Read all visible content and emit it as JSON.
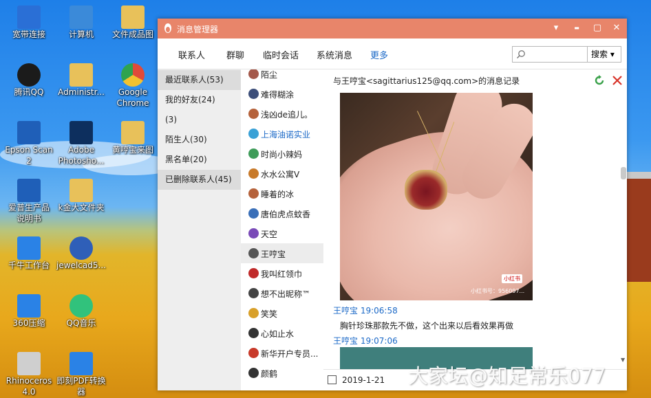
{
  "desktop": {
    "icons": [
      {
        "label": "宽带连接",
        "icon": "network-icon",
        "color": "#2a6fd6"
      },
      {
        "label": "计算机",
        "icon": "computer-icon",
        "color": "#3b8ad9"
      },
      {
        "label": "文件成品图",
        "icon": "folder-icon",
        "color": "#e8c15a"
      },
      {
        "label": "腾讯QQ",
        "icon": "qq-icon",
        "color": "#1b1b1b"
      },
      {
        "label": "Administr...",
        "icon": "user-folder-icon",
        "color": "#e8c15a"
      },
      {
        "label": "Google",
        "label2": "Chrome",
        "icon": "chrome-icon",
        "color": "#e04a3a"
      },
      {
        "label": "Epson Scan",
        "label2": "2",
        "icon": "scanner-icon",
        "color": "#1f5fb8"
      },
      {
        "label": "Adobe",
        "label2": "Photosho...",
        "icon": "photoshop-icon",
        "color": "#0d2f5e"
      },
      {
        "label": "黄哼宝来图",
        "icon": "folder-icon",
        "color": "#e8c15a"
      },
      {
        "label": "爱普生产品",
        "label2": "说明书",
        "icon": "manual-icon",
        "color": "#1f5fb8"
      },
      {
        "label": "k金大文件夹",
        "icon": "folder-icon",
        "color": "#e8c15a"
      },
      {
        "label": "千牛工作台",
        "icon": "qianniu-icon",
        "color": "#2a82e6"
      },
      {
        "label": "jewelcad5...",
        "icon": "jewelcad-icon",
        "color": "#2f5fb8"
      },
      {
        "label": "360压缩",
        "icon": "zip-icon",
        "color": "#2a82e6"
      },
      {
        "label": "QQ音乐",
        "icon": "qqmusic-icon",
        "color": "#31c27c"
      },
      {
        "label": "Rhinoceros",
        "label2": "4.0",
        "icon": "rhino-icon",
        "color": "#cfcfcf"
      },
      {
        "label": "即刻PDF转换",
        "label2": "器",
        "icon": "pdf-converter-icon",
        "color": "#2a82e6"
      }
    ]
  },
  "window": {
    "title": "消息管理器",
    "controls": {
      "menu": "▾",
      "minimize": "▬",
      "maximize": "▢",
      "close": "✕"
    },
    "nav": [
      "联系人",
      "群聊",
      "临时会话",
      "系统消息",
      "更多"
    ],
    "search": {
      "placeholder": "",
      "button": "搜索 ▾"
    },
    "left_items": [
      {
        "label": "最近联系人(53)",
        "selected": true
      },
      {
        "label": "我的好友(24)",
        "selected": false
      },
      {
        "label": "(3)",
        "selected": false
      },
      {
        "label": "陌生人(30)",
        "selected": false
      },
      {
        "label": "黑名单(20)",
        "selected": false
      },
      {
        "label": "已删除联系人(45)",
        "selected": true
      }
    ],
    "contacts": [
      {
        "name": "陌尘",
        "color": "#a4584a"
      },
      {
        "name": "难得糊涂",
        "color": "#3d4f7a"
      },
      {
        "name": "浅凶de追儿。",
        "color": "#b5623b"
      },
      {
        "name": "上海油诺实业",
        "color": "#3aa1d6"
      },
      {
        "name": "时尚小辣妈",
        "color": "#3f9c5a"
      },
      {
        "name": "水水公寓V",
        "color": "#c87a2a"
      },
      {
        "name": "睡着的冰",
        "color": "#b5623b"
      },
      {
        "name": "唐伯虎点蚊香",
        "color": "#3a6fb8"
      },
      {
        "name": "天空",
        "color": "#7a4ab8"
      },
      {
        "name": "王哼宝",
        "color": "#555555",
        "selected": true
      },
      {
        "name": "我叫红领巾",
        "color": "#c02a2a"
      },
      {
        "name": "想不出昵称™",
        "color": "#444444"
      },
      {
        "name": "笑笑",
        "color": "#d8a02a"
      },
      {
        "name": "心如止水",
        "color": "#333333"
      },
      {
        "name": "新华开户专员...",
        "color": "#c83a2a"
      },
      {
        "name": "颜鹤",
        "color": "#333333"
      }
    ],
    "chat": {
      "header": "与王哼宝<sagittarius125@qq.com>的消息记录",
      "photo_watermark": "小红书",
      "photo_id": "小红书号：956097...",
      "messages": [
        {
          "sender": "王哼宝",
          "time": "19:06:58",
          "text": "胸针珍珠那款先不做，这个出来以后看效果再做"
        },
        {
          "sender": "王哼宝",
          "time": "19:07:06",
          "text": ""
        }
      ],
      "date": "2019-1-21"
    }
  },
  "watermark": "大家坛@知足常乐077"
}
